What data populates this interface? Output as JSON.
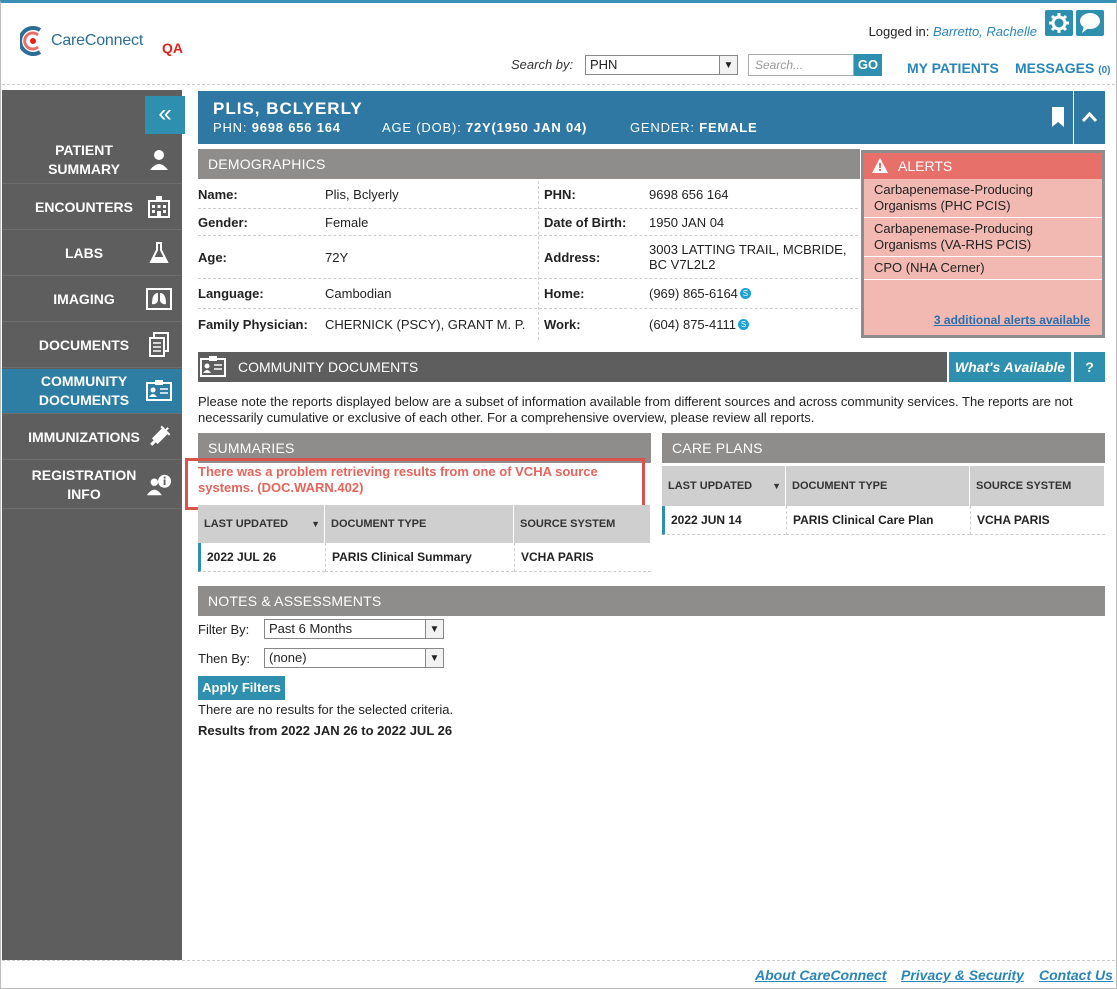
{
  "header": {
    "app_name": "CareConnect",
    "env_badge": "QA",
    "logged_in_label": "Logged in:",
    "logged_in_user": "Barretto, Rachelle",
    "search_by_label": "Search by:",
    "search_by_value": "PHN",
    "search_placeholder": "Search...",
    "go_label": "GO",
    "my_patients": "MY PATIENTS",
    "messages": "MESSAGES",
    "messages_count": "(0)"
  },
  "sidebar": {
    "collapse_glyph": "«",
    "items": [
      {
        "label_line1": "PATIENT",
        "label_line2": "SUMMARY",
        "icon": "person-icon"
      },
      {
        "label_line1": "ENCOUNTERS",
        "label_line2": "",
        "icon": "hospital-icon"
      },
      {
        "label_line1": "LABS",
        "label_line2": "",
        "icon": "flask-icon"
      },
      {
        "label_line1": "IMAGING",
        "label_line2": "",
        "icon": "lungs-xray-icon"
      },
      {
        "label_line1": "DOCUMENTS",
        "label_line2": "",
        "icon": "documents-icon"
      },
      {
        "label_line1": "COMMUNITY",
        "label_line2": "DOCUMENTS",
        "icon": "id-card-icon",
        "active": true
      },
      {
        "label_line1": "IMMUNIZATIONS",
        "label_line2": "",
        "icon": "syringe-icon"
      },
      {
        "label_line1": "REGISTRATION",
        "label_line2": "INFO",
        "icon": "person-info-icon"
      }
    ]
  },
  "patient": {
    "name": "PLIS, BCLYERLY",
    "phn_label": "PHN:",
    "phn": "9698 656 164",
    "age_label": "AGE (DOB):",
    "age_dob": "72Y(1950 JAN 04)",
    "gender_label": "GENDER:",
    "gender": "FEMALE"
  },
  "demographics": {
    "title": "DEMOGRAPHICS",
    "rows": [
      {
        "l1": "Name:",
        "v1": "Plis, Bclyerly",
        "l2": "PHN:",
        "v2": "9698 656 164"
      },
      {
        "l1": "Gender:",
        "v1": "Female",
        "l2": "Date of Birth:",
        "v2": "1950 JAN 04"
      },
      {
        "l1": "Age:",
        "v1": "72Y",
        "l2": "Address:",
        "v2": "3003 LATTING TRAIL, MCBRIDE,",
        "v2b": "BC V7L2L2"
      },
      {
        "l1": "Language:",
        "v1": "Cambodian",
        "l2": "Home:",
        "v2": "(969) 865-6164"
      },
      {
        "l1": "Family Physician:",
        "v1": "CHERNICK (PSCY), GRANT M. P.",
        "l2": "Work:",
        "v2": "(604) 875-4111"
      }
    ]
  },
  "alerts": {
    "title": "ALERTS",
    "items": [
      "Carbapenemase-Producing Organisms (PHC PCIS)",
      "Carbapenemase-Producing Organisms (VA-RHS PCIS)",
      "CPO (NHA Cerner)"
    ],
    "more": "3 additional alerts available"
  },
  "community_documents": {
    "title": "COMMUNITY DOCUMENTS",
    "whats_available": "What's Available",
    "help": "?",
    "note": "Please note the reports displayed below are a subset of information available from different sources and across community services. The reports are not necessarily cumulative or exclusive of each other. For a comprehensive overview, please review all reports."
  },
  "summaries": {
    "title": "SUMMARIES",
    "error": "There was a problem retrieving results from one of VCHA source systems. (DOC.WARN.402)",
    "columns": [
      "LAST UPDATED",
      "DOCUMENT TYPE",
      "SOURCE SYSTEM"
    ],
    "sort_glyph": "▼",
    "rows": [
      [
        "2022 JUL 26",
        "PARIS Clinical Summary",
        "VCHA PARIS"
      ]
    ]
  },
  "care_plans": {
    "title": "CARE PLANS",
    "columns": [
      "LAST UPDATED",
      "DOCUMENT TYPE",
      "SOURCE SYSTEM"
    ],
    "sort_glyph": "▼",
    "rows": [
      [
        "2022 JUN 14",
        "PARIS Clinical Care Plan",
        "VCHA PARIS"
      ]
    ]
  },
  "notes": {
    "title": "NOTES & ASSESSMENTS",
    "filter_label": "Filter By:",
    "filter_value": "Past 6 Months",
    "then_label": "Then By:",
    "then_value": "(none)",
    "apply": "Apply Filters",
    "no_results": "There are no results for the selected criteria.",
    "results_range": "Results from 2022 JAN 26 to 2022 JUL 26"
  },
  "footer": {
    "about": "About CareConnect",
    "privacy": "Privacy & Security",
    "contact": "Contact Us"
  }
}
